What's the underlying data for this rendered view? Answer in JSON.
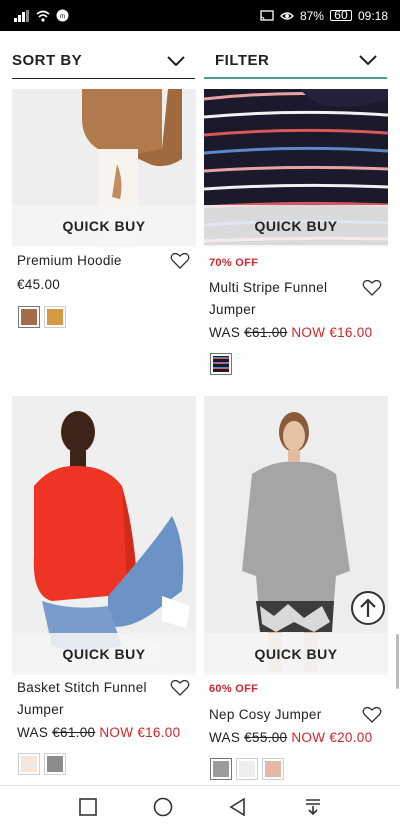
{
  "status_bar": {
    "battery_percent": "87%",
    "time": "09:18",
    "battery_level": "60"
  },
  "controls": {
    "sort_label": "SORT BY",
    "filter_label": "FILTER"
  },
  "products": [
    {
      "name": "Premium Hoodie",
      "price": "€45.00",
      "quick_buy": "QUICK BUY",
      "swatches": [
        "#a56b4b",
        "#d69a45"
      ]
    },
    {
      "badge": "70% OFF",
      "name_line1": "Multi Stripe Funnel",
      "name_line2": "Jumper",
      "was_label": "WAS",
      "was_price": "€61.00",
      "now_label": "NOW €16.00",
      "quick_buy": "QUICK BUY",
      "swatches": [
        "#3a2f3f"
      ]
    },
    {
      "name_line1": "Basket Stitch Funnel",
      "name_line2": "Jumper",
      "was_label": "WAS",
      "was_price": "€61.00",
      "now_label": "NOW €16.00",
      "quick_buy": "QUICK BUY",
      "swatches": [
        "#f5e6dd",
        "#8b8b8b"
      ]
    },
    {
      "badge": "60% OFF",
      "name": "Nep Cosy Jumper",
      "was_label": "WAS",
      "was_price": "€55.00",
      "now_label": "NOW €20.00",
      "quick_buy": "QUICK BUY",
      "swatches": [
        "#9b9b9b",
        "#eeeeee",
        "#e3b8a7"
      ]
    }
  ],
  "icons": {
    "scroll_top": "arrow-up-icon",
    "nav": [
      "square-icon",
      "circle-icon",
      "triangle-back-icon",
      "download-icon"
    ]
  },
  "colors": {
    "sale_red": "#d0252d",
    "filter_accent": "#4a9e93"
  }
}
